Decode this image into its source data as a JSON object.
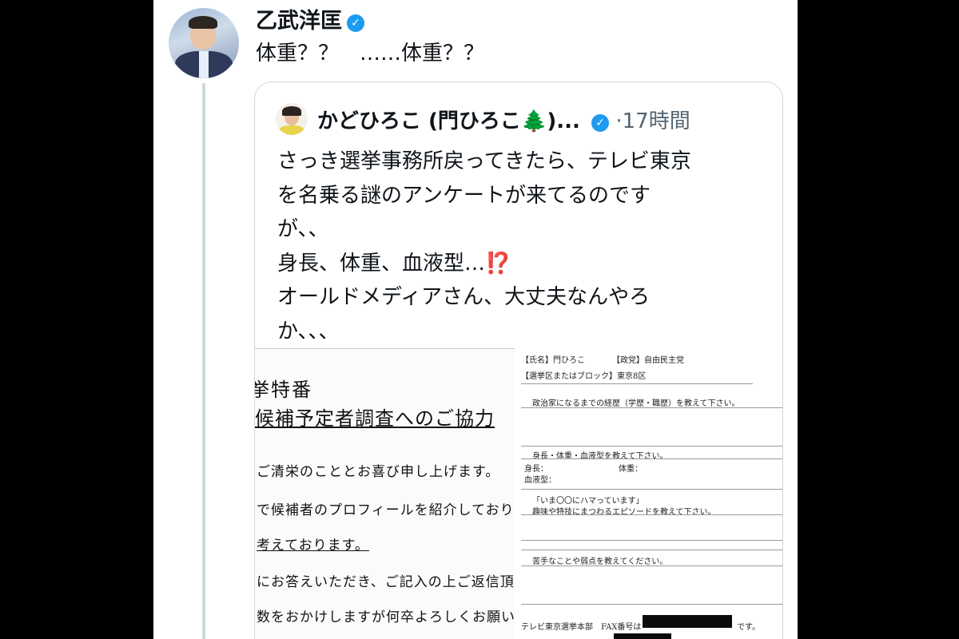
{
  "tweet": {
    "author_name": "乙武洋匡",
    "text": "体重？？　……体重？？"
  },
  "quote": {
    "author_name": "かどひろこ (門ひろこ",
    "author_emoji": "🌲",
    "author_suffix": ")...",
    "separator": "·",
    "time": "17時間",
    "lines": [
      "さっき選挙事務所戻ってきたら、テレビ東京",
      "を名乗る謎のアンケートが来てるのです",
      "が、、",
      "身長、体重、血液型…",
      "オールドメディアさん、大丈夫なんやろ",
      "か、、、"
    ],
    "alert_emoji": "⁉️"
  },
  "image": {
    "left_doc": {
      "title1": "挙特番",
      "title2": "候補予定者調査へのご協力",
      "para1": "ご清栄のこととお喜び申し上げます。",
      "para2": "で候補者のプロフィールを紹介しており",
      "para3": "考えております。",
      "para4": "にお答えいただき、ご記入の上ご返信頂き",
      "para5": "数をおかけしますが何卒よろしくお願い申"
    },
    "right_doc": {
      "name_label": "【氏名】門ひろこ",
      "party_label": "【政党】自由民主党",
      "district_label": "【選挙区またはブロック】東京8区",
      "q1": "政治家になるまでの経歴（学歴・職歴）を教えて下さい。",
      "q2": "身長・体重・血液型を教えて下さい。",
      "height_label": "身長：",
      "weight_label": "体重：",
      "blood_label": "血液型：",
      "q3a": "「いま〇〇にハマっています」",
      "q3b": "趣味や特技にまつわるエピソードを教えて下さい。",
      "q4": "苦手なことや弱点を教えてください。",
      "footer": "テレビ東京選挙本部　FAX番号は",
      "footer_end": "です。"
    }
  },
  "colors": {
    "verified": "#1d9bf0",
    "border": "#cfd9de",
    "meta": "#536471",
    "alert": "#e0242b"
  }
}
